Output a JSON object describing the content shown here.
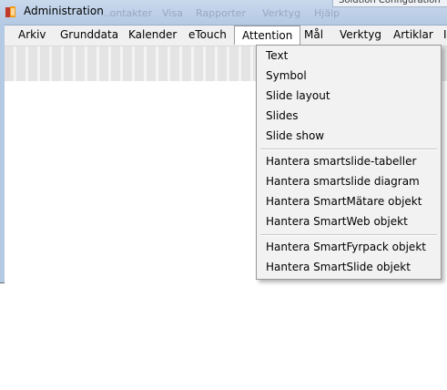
{
  "window": {
    "title": "Administration",
    "background_menu_ghost": [
      "...ontakter",
      "Visa",
      "Rapporter",
      "Verktyg",
      "Hjälp"
    ],
    "popup_title": "Solution Configuration"
  },
  "menubar": {
    "items": [
      {
        "label": "Arkiv"
      },
      {
        "label": "Grunddata"
      },
      {
        "label": "Kalender"
      },
      {
        "label": "eTouch"
      },
      {
        "label": "Attention"
      },
      {
        "label": "Mål"
      },
      {
        "label": "Verktyg"
      },
      {
        "label": "Artiklar"
      },
      {
        "label": "I"
      }
    ],
    "active_item": "Attention"
  },
  "dropdown": {
    "items": [
      {
        "label": "Text"
      },
      {
        "label": "Symbol"
      },
      {
        "label": "Slide layout"
      },
      {
        "label": "Slides"
      },
      {
        "label": "Slide show"
      },
      {
        "label": "Hantera smartslide-tabeller"
      },
      {
        "label": "Hantera smartslide diagram"
      },
      {
        "label": "Hantera SmartMätare objekt"
      },
      {
        "label": "Hantera SmartWeb objekt"
      },
      {
        "label": "Hantera SmartFyrpack objekt"
      },
      {
        "label": "Hantera SmartSlide objekt"
      }
    ]
  },
  "colors": {
    "titlebar": "#b4c9e3",
    "menubar": "#f0f0f0",
    "dropdown_bg": "#f2f2f2",
    "dropdown_border": "#979797"
  }
}
